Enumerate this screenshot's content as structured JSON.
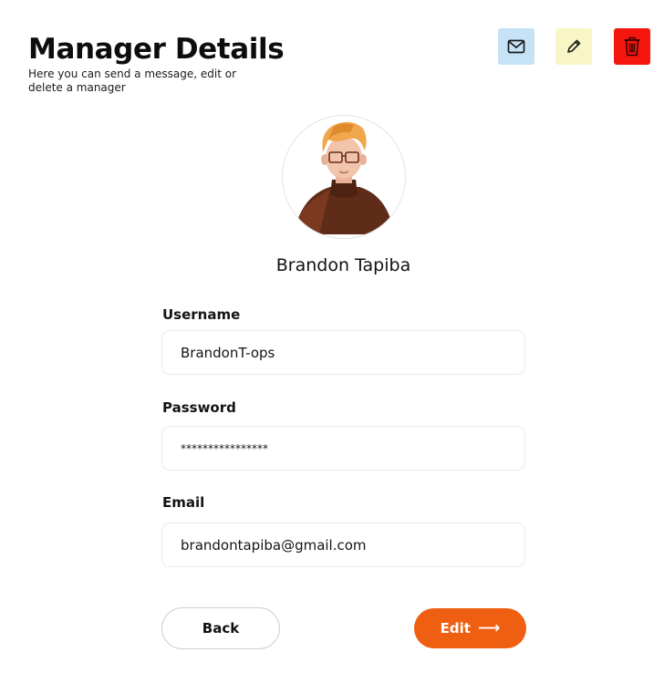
{
  "header": {
    "title": "Manager Details",
    "subtitle": "Here you can send a message, edit or delete a manager"
  },
  "actions": {
    "mail_icon": "mail-icon",
    "edit_icon": "pencil-icon",
    "delete_icon": "trash-icon",
    "colors": {
      "mail_bg": "#c6e2f6",
      "edit_bg": "#f7f6c4",
      "delete_bg": "#f5170f"
    }
  },
  "profile": {
    "name": "Brandon Tapiba"
  },
  "fields": {
    "username": {
      "label": "Username",
      "value": "BrandonT-ops"
    },
    "password": {
      "label": "Password",
      "value": "****************"
    },
    "email": {
      "label": "Email",
      "value": "brandontapiba@gmail.com"
    }
  },
  "buttons": {
    "back_label": "Back",
    "edit_label": "Edit",
    "edit_arrow": "⟶",
    "accent": "#ef5f12"
  }
}
